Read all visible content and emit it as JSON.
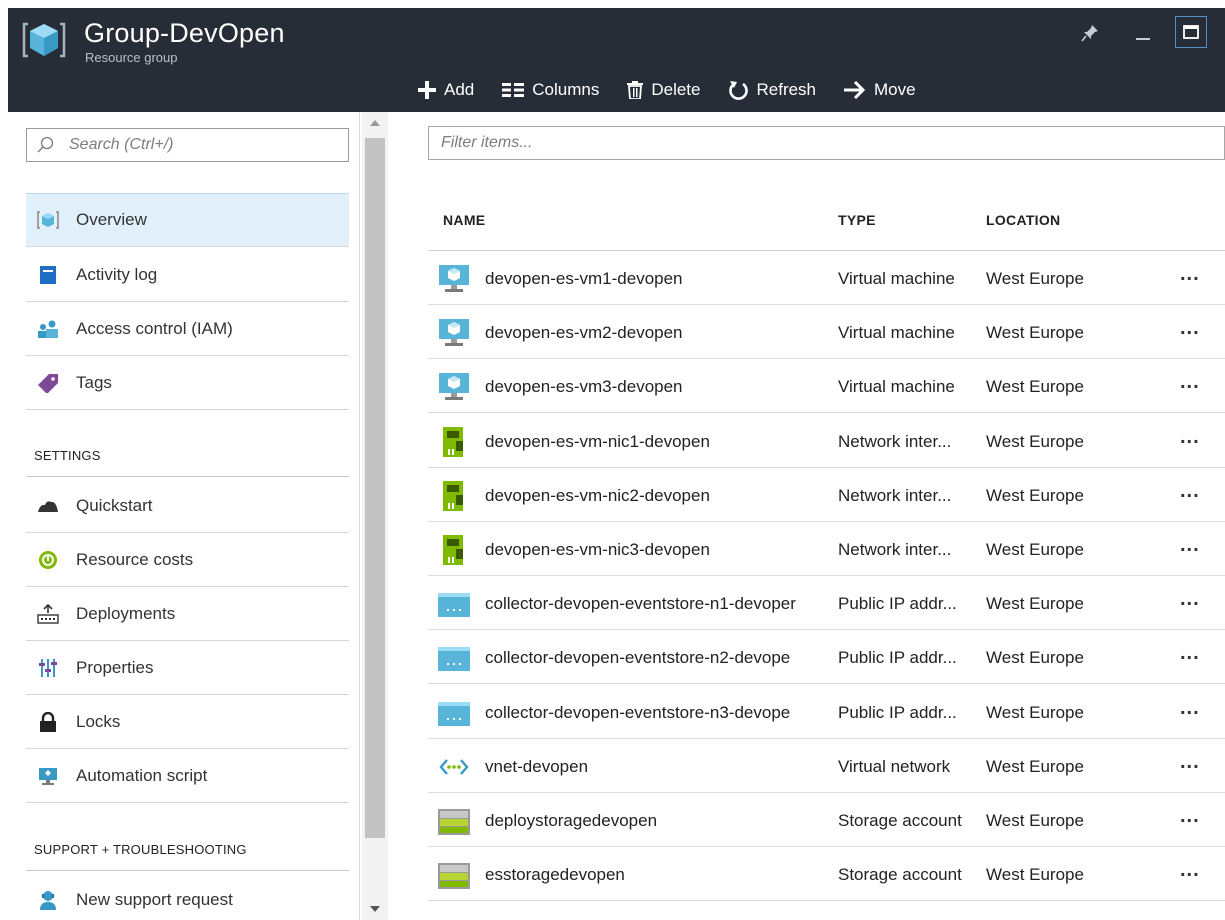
{
  "header": {
    "title": "Group-DevOpen",
    "subtitle": "Resource group"
  },
  "toolbar": {
    "add": "Add",
    "columns": "Columns",
    "delete": "Delete",
    "refresh": "Refresh",
    "move": "Move"
  },
  "sidebar": {
    "search_placeholder": "Search (Ctrl+/)",
    "items": [
      {
        "label": "Overview",
        "icon": "resource-group-icon",
        "selected": true
      },
      {
        "label": "Activity log",
        "icon": "activity-log-icon"
      },
      {
        "label": "Access control (IAM)",
        "icon": "users-icon"
      },
      {
        "label": "Tags",
        "icon": "tag-icon"
      }
    ],
    "settings_heading": "SETTINGS",
    "settings_items": [
      {
        "label": "Quickstart",
        "icon": "quickstart-icon"
      },
      {
        "label": "Resource costs",
        "icon": "cost-icon"
      },
      {
        "label": "Deployments",
        "icon": "deployments-icon"
      },
      {
        "label": "Properties",
        "icon": "properties-icon"
      },
      {
        "label": "Locks",
        "icon": "lock-icon"
      },
      {
        "label": "Automation script",
        "icon": "automation-icon"
      }
    ],
    "support_heading": "SUPPORT + TROUBLESHOOTING",
    "support_items": [
      {
        "label": "New support request",
        "icon": "support-icon"
      }
    ]
  },
  "main": {
    "filter_placeholder": "Filter items...",
    "columns": [
      "NAME",
      "TYPE",
      "LOCATION"
    ],
    "more_label": "...",
    "rows": [
      {
        "name": "devopen-es-vm1-devopen",
        "type": "Virtual machine",
        "location": "West Europe",
        "icon": "vm-icon"
      },
      {
        "name": "devopen-es-vm2-devopen",
        "type": "Virtual machine",
        "location": "West Europe",
        "icon": "vm-icon"
      },
      {
        "name": "devopen-es-vm3-devopen",
        "type": "Virtual machine",
        "location": "West Europe",
        "icon": "vm-icon"
      },
      {
        "name": "devopen-es-vm-nic1-devopen",
        "type": "Network inter...",
        "location": "West Europe",
        "icon": "nic-icon"
      },
      {
        "name": "devopen-es-vm-nic2-devopen",
        "type": "Network inter...",
        "location": "West Europe",
        "icon": "nic-icon"
      },
      {
        "name": "devopen-es-vm-nic3-devopen",
        "type": "Network inter...",
        "location": "West Europe",
        "icon": "nic-icon"
      },
      {
        "name": "collector-devopen-eventstore-n1-devoper",
        "type": "Public IP addr...",
        "location": "West Europe",
        "icon": "public-ip-icon"
      },
      {
        "name": "collector-devopen-eventstore-n2-devope",
        "type": "Public IP addr...",
        "location": "West Europe",
        "icon": "public-ip-icon"
      },
      {
        "name": "collector-devopen-eventstore-n3-devope",
        "type": "Public IP addr...",
        "location": "West Europe",
        "icon": "public-ip-icon"
      },
      {
        "name": "vnet-devopen",
        "type": "Virtual network",
        "location": "West Europe",
        "icon": "vnet-icon"
      },
      {
        "name": "deploystoragedevopen",
        "type": "Storage account",
        "location": "West Europe",
        "icon": "storage-icon"
      },
      {
        "name": "esstoragedevopen",
        "type": "Storage account",
        "location": "West Europe",
        "icon": "storage-icon"
      }
    ]
  }
}
